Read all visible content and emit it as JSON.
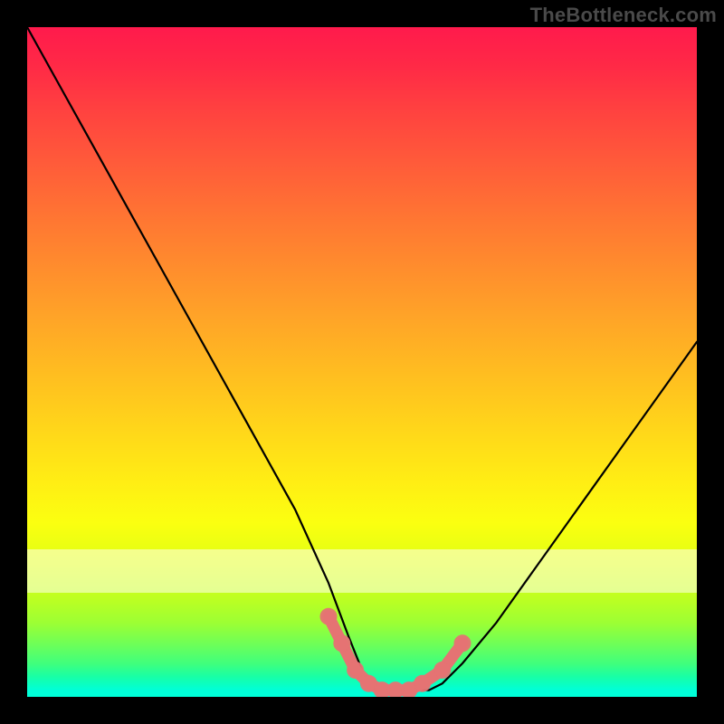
{
  "watermark": "TheBottleneck.com",
  "chart_data": {
    "type": "line",
    "title": "",
    "xlabel": "",
    "ylabel": "",
    "xlim": [
      0,
      100
    ],
    "ylim": [
      0,
      100
    ],
    "grid": false,
    "legend": false,
    "series": [
      {
        "name": "bottleneck-curve",
        "color": "#000000",
        "x": [
          0,
          5,
          10,
          15,
          20,
          25,
          30,
          35,
          40,
          45,
          48,
          50,
          52,
          55,
          58,
          60,
          62,
          65,
          70,
          75,
          80,
          85,
          90,
          95,
          100
        ],
        "values": [
          100,
          91,
          82,
          73,
          64,
          55,
          46,
          37,
          28,
          17,
          9,
          4,
          2,
          1,
          1,
          1,
          2,
          5,
          11,
          18,
          25,
          32,
          39,
          46,
          53
        ]
      }
    ],
    "markers": {
      "name": "optimal-zone",
      "color": "#e57373",
      "x": [
        45,
        47,
        49,
        51,
        53,
        55,
        57,
        59,
        62,
        65
      ],
      "values": [
        12,
        8,
        4,
        2,
        1,
        1,
        1,
        2,
        4,
        8
      ]
    },
    "background_gradient": {
      "top": "#ff1a4c",
      "mid": "#ffee14",
      "bottom": "#00ffd8"
    }
  }
}
